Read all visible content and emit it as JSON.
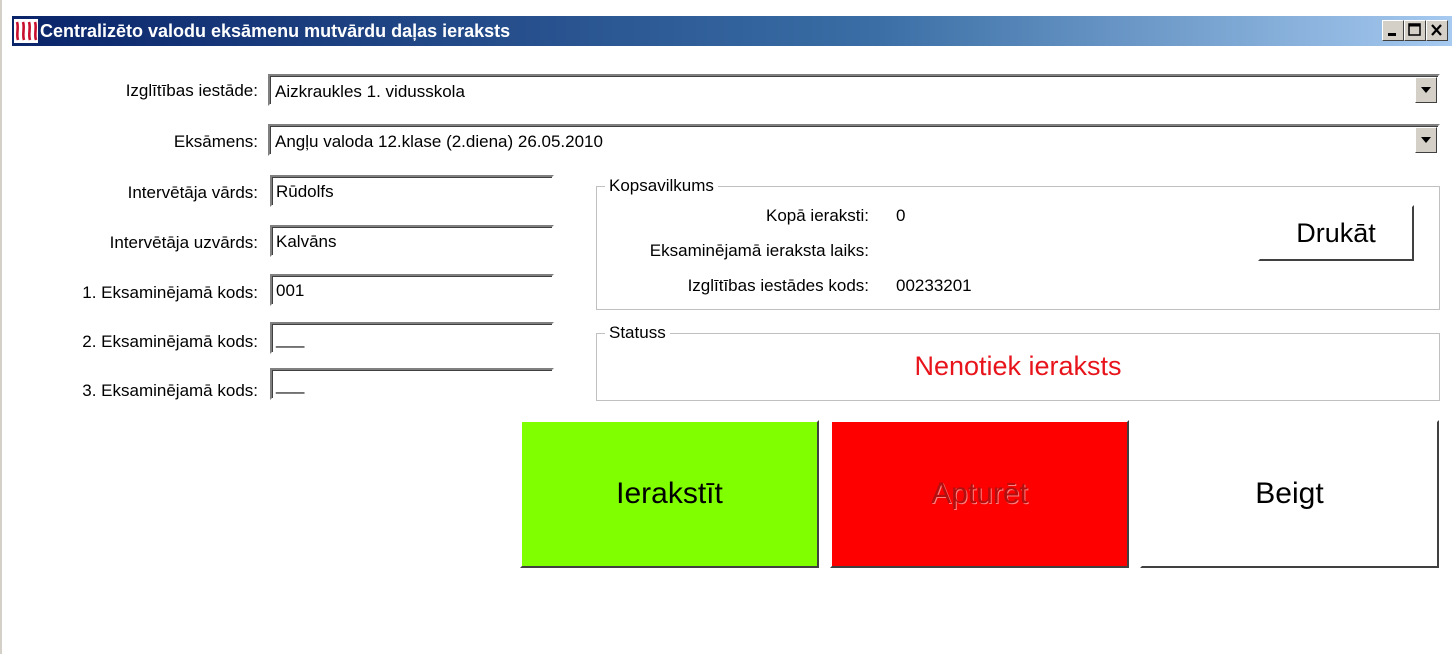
{
  "window": {
    "title": "Centralizēto valodu eksāmenu mutvārdu daļas ieraksts"
  },
  "form": {
    "school_label": "Izglītības iestāde:",
    "school_value": "Aizkraukles 1. vidusskola",
    "exam_label": "Eksāmens:",
    "exam_value": "Angļu valoda 12.klase (2.diena) 26.05.2010",
    "interviewer_first_label": "Intervētāja vārds:",
    "interviewer_first_value": "Rūdolfs",
    "interviewer_last_label": "Intervētāja uzvārds:",
    "interviewer_last_value": "Kalvāns",
    "examinee1_label": "1. Eksaminējamā kods:",
    "examinee1_value": "001",
    "examinee2_label": "2. Eksaminējamā kods:",
    "examinee2_value": "___",
    "examinee3_label": "3. Eksaminējamā kods:",
    "examinee3_value": "___"
  },
  "summary": {
    "title": "Kopsavilkums",
    "total_label": "Kopā ieraksti:",
    "total_value": "0",
    "time_label": "Eksaminējamā ieraksta laiks:",
    "time_value": "",
    "school_code_label": "Izglītības iestādes kods:",
    "school_code_value": "00233201",
    "print_label": "Drukāt"
  },
  "status": {
    "title": "Statuss",
    "text": "Nenotiek ieraksts",
    "color": "#e8141c"
  },
  "actions": {
    "record_label": "Ierakstīt",
    "record_color": "#80ff00",
    "pause_label": "Apturēt",
    "pause_color": "#ff0000",
    "finish_label": "Beigt"
  }
}
